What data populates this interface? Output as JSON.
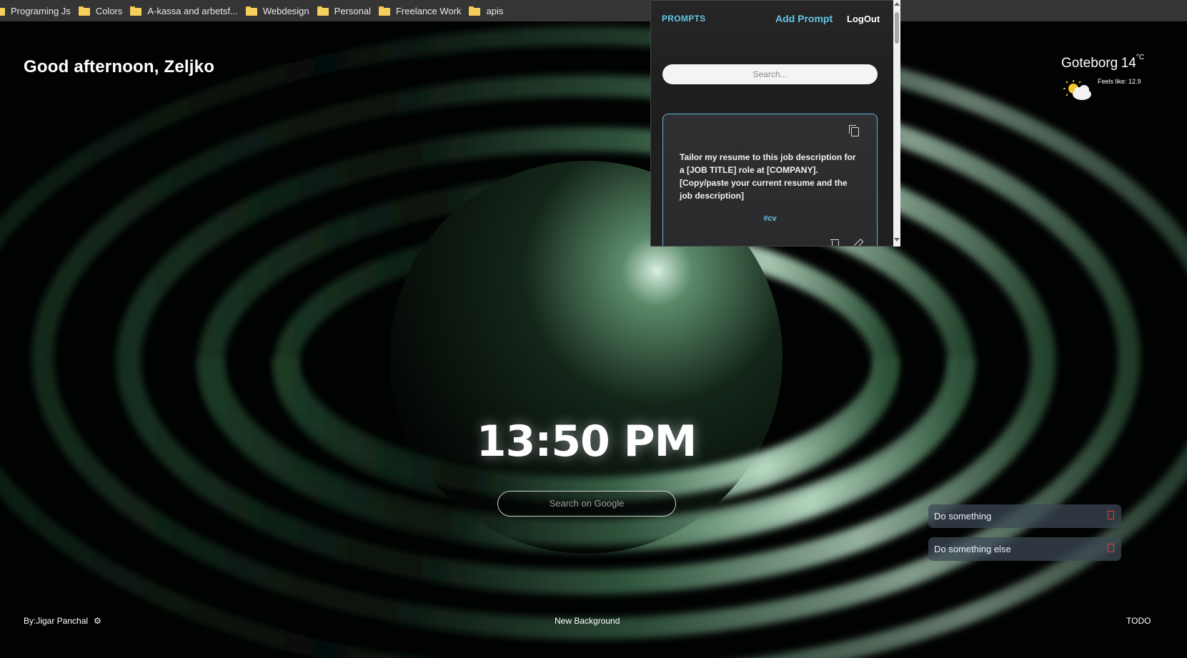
{
  "bookmarks": [
    {
      "label": "Programing Js",
      "icon": "folder-icon"
    },
    {
      "label": "Colors",
      "icon": "folder-icon"
    },
    {
      "label": "A-kassa and arbetsf...",
      "icon": "folder-icon"
    },
    {
      "label": "Webdesign",
      "icon": "folder-icon"
    },
    {
      "label": "Personal",
      "icon": "folder-icon"
    },
    {
      "label": "Freelance Work",
      "icon": "folder-icon"
    },
    {
      "label": "apis",
      "icon": "folder-icon"
    }
  ],
  "greeting": "Good afternoon, Zeljko",
  "weather": {
    "city": "Goteborg",
    "temp": "14",
    "unit": "°C",
    "feels": "Feels like: 12.9",
    "icon": "partly-cloudy-icon"
  },
  "clock": "13:50 PM",
  "google_search": {
    "placeholder": "Search on Google"
  },
  "todos": [
    {
      "label": "Do something"
    },
    {
      "label": "Do something else"
    }
  ],
  "footer": {
    "credit": "By:Jigar Panchal",
    "new_background": "New Background",
    "todo": "TODO"
  },
  "prompts_popup": {
    "title": "PROMPTS",
    "add_prompt": "Add Prompt",
    "logout": "LogOut",
    "search_placeholder": "Search...",
    "card": {
      "text": "Tailor my resume to this job description for a [JOB TITLE] role at [COMPANY]. [Copy/paste your current resume and the job description]",
      "tag": "#cv"
    }
  },
  "colors": {
    "accent": "#63c5e6",
    "todo_bg": "#3c4854",
    "trash": "#e04040"
  }
}
